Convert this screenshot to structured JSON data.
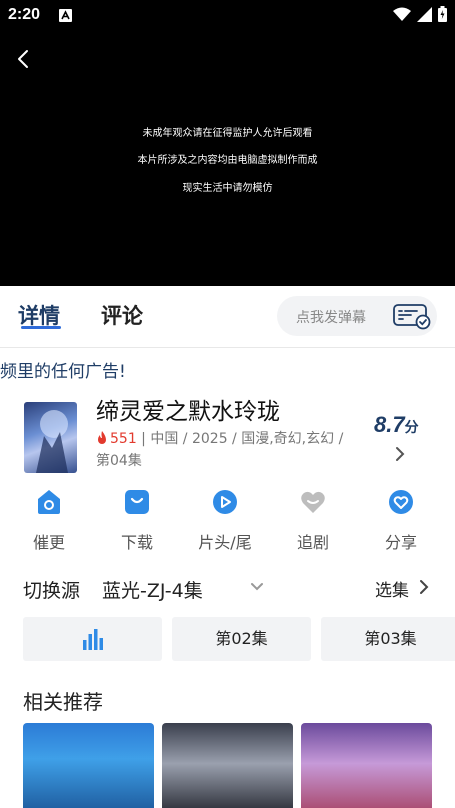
{
  "status_bar": {
    "time": "2:20"
  },
  "player": {
    "notice_lines": [
      "未成年观众请在征得监护人允许后观看",
      "本片所涉及之内容均由电脑虚拟制作而成",
      "现实生活中请勿模仿"
    ]
  },
  "tabs": {
    "detail": "详情",
    "comment": "评论",
    "danmu_placeholder": "点我发弹幕"
  },
  "marquee_text": "频里的任何广告!",
  "show": {
    "title": "缔灵爱之默水玲珑",
    "heat": "551",
    "info_line": " | 中国 / 2025 / 国漫,奇幻,玄幻 / 第04集",
    "score": "8.7",
    "score_unit": "分"
  },
  "actions": [
    {
      "label": "催更",
      "icon": "house-icon"
    },
    {
      "label": "下载",
      "icon": "download-icon"
    },
    {
      "label": "片头/尾",
      "icon": "play-icon"
    },
    {
      "label": "追剧",
      "icon": "heart-icon"
    },
    {
      "label": "分享",
      "icon": "share-icon"
    }
  ],
  "source": {
    "label": "切换源",
    "value": "蓝光-ZJ-4集",
    "episodes_link": "选集"
  },
  "episodes": [
    "第02集",
    "第03集"
  ],
  "recommend": {
    "title": "相关推荐"
  },
  "colors": {
    "accent": "#2f6bd9",
    "heat": "#e23a2e",
    "navy": "#1f3d66"
  }
}
